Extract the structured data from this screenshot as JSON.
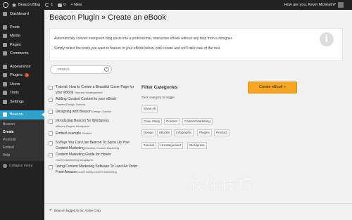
{
  "admin_bar": {
    "site_name": "Beacon Blog",
    "updates": "1",
    "comments": "0",
    "new_label": "+ New",
    "howdy": "How are you, Kevin McGrath?"
  },
  "sidebar": {
    "items": [
      {
        "label": "Dashboard",
        "icon": "dashboard-icon"
      },
      {
        "label": "Posts",
        "icon": "pin-icon"
      },
      {
        "label": "Media",
        "icon": "media-icon"
      },
      {
        "label": "Pages",
        "icon": "pages-icon"
      },
      {
        "label": "Comments",
        "icon": "comments-icon"
      },
      {
        "label": "Appearance",
        "icon": "brush-icon"
      },
      {
        "label": "Plugins",
        "icon": "plugin-icon",
        "badge": "1"
      },
      {
        "label": "Users",
        "icon": "users-icon"
      },
      {
        "label": "Tools",
        "icon": "tools-icon"
      },
      {
        "label": "Settings",
        "icon": "settings-icon"
      },
      {
        "label": "Beacon",
        "icon": "beacon-icon"
      }
    ],
    "submenu": [
      "Beacon",
      "Create",
      "Promote",
      "Embed",
      "Help"
    ],
    "collapse": "Collapse menu"
  },
  "page": {
    "title": "Beacon Plugin » Create an eBook",
    "intro1": "Automatically convert evergreen blog posts into a professional, interactive eBook without any help from a designer.",
    "intro2": "Simply select the posts you want to feature in your eBook below, click create and we'll take care of the rest.",
    "search_placeholder": "search",
    "create_button": "Create eBook »",
    "logged_in": "Beacon logged in as: Acme Corp"
  },
  "posts": [
    {
      "title": "Tutorial: How to Create a Beautiful Cover Page for your eBook",
      "cats": "Tutorial,Uncategorised"
    },
    {
      "title": "Adding Curated Content to your eBook",
      "cats": "Content,Design,Tutorial"
    },
    {
      "title": "Designing with Beacon",
      "cats": "Design,Tutorial"
    },
    {
      "title": "Introducing Beacon for Wordpress",
      "cats": "eBooks,Plugins,Wordpress"
    },
    {
      "title": "Embed example",
      "cats": "Product"
    },
    {
      "title": "5 Ways You Can Use Beacon To Spice Up Your Content Marketing",
      "cats": "Content,Content Marketing"
    },
    {
      "title": "Content Marketing Guide for Hotels",
      "cats": "Content Marketing,Infographic"
    },
    {
      "title": "Using Content Marketing Software To Land An Order From Amazon",
      "cats": "Case Study,Content Marketing"
    }
  ],
  "filter": {
    "title": "Filter Categories",
    "hint": "Click category to toggle",
    "show_all": "Show All",
    "categories": [
      "Case Study",
      "Content",
      "Content Marketing",
      "Design",
      "eBooks",
      "Infographic",
      "Plugins",
      "Product",
      "Tutorial",
      "Uncategorised",
      "Wordpress"
    ]
  },
  "watermark": "软件技巧",
  "colors": {
    "accent": "#2ea2cc",
    "create_button": "#f6a623",
    "admin_dark": "#222222"
  }
}
